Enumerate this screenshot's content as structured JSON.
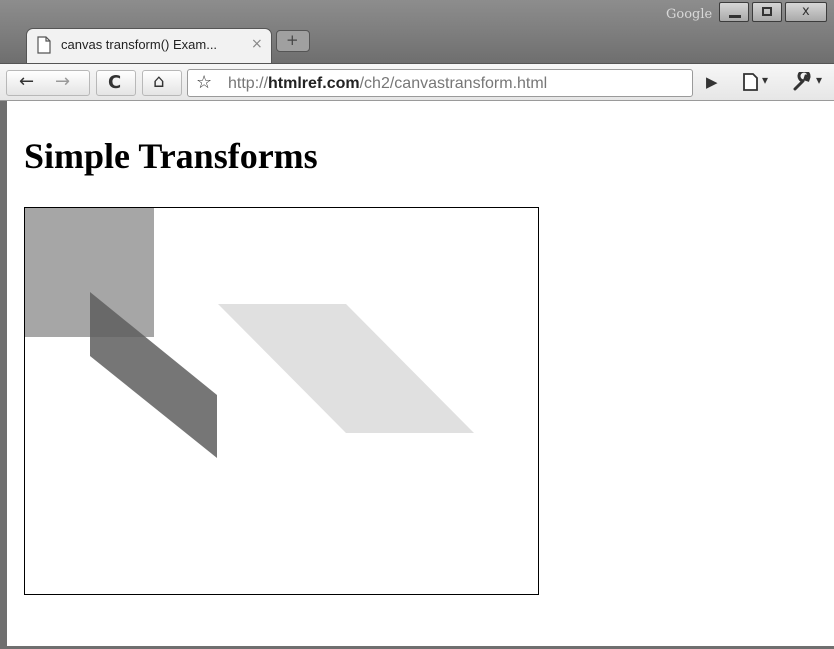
{
  "window": {
    "search_brand": "Google",
    "controls": {
      "minimize": "minimize",
      "maximize": "maximize",
      "close": "x"
    }
  },
  "tab": {
    "title": "canvas transform() Exam...",
    "close_glyph": "×",
    "new_tab_glyph": "+"
  },
  "toolbar": {
    "back_glyph": "←",
    "forward_glyph": "→",
    "reload_glyph": "C",
    "home_glyph": "⌂",
    "url_prefix": "http://",
    "url_host": "htmlref.com",
    "url_path": "/ch2/canvastransform.html",
    "play_glyph": "▶",
    "page_menu_glyph": "▾",
    "tools_menu_glyph": "▾"
  },
  "page": {
    "heading": "Simple Transforms"
  },
  "canvas": {
    "shapes": [
      {
        "name": "square",
        "fill": "#a6a6a6"
      },
      {
        "name": "skewed-dark",
        "fill": "#5e5e5e"
      },
      {
        "name": "skewed-light",
        "fill": "#e0e0e0"
      }
    ]
  },
  "colors": {
    "chrome_dark": "#6f6f6f",
    "toolbar": "#eeeeee"
  }
}
